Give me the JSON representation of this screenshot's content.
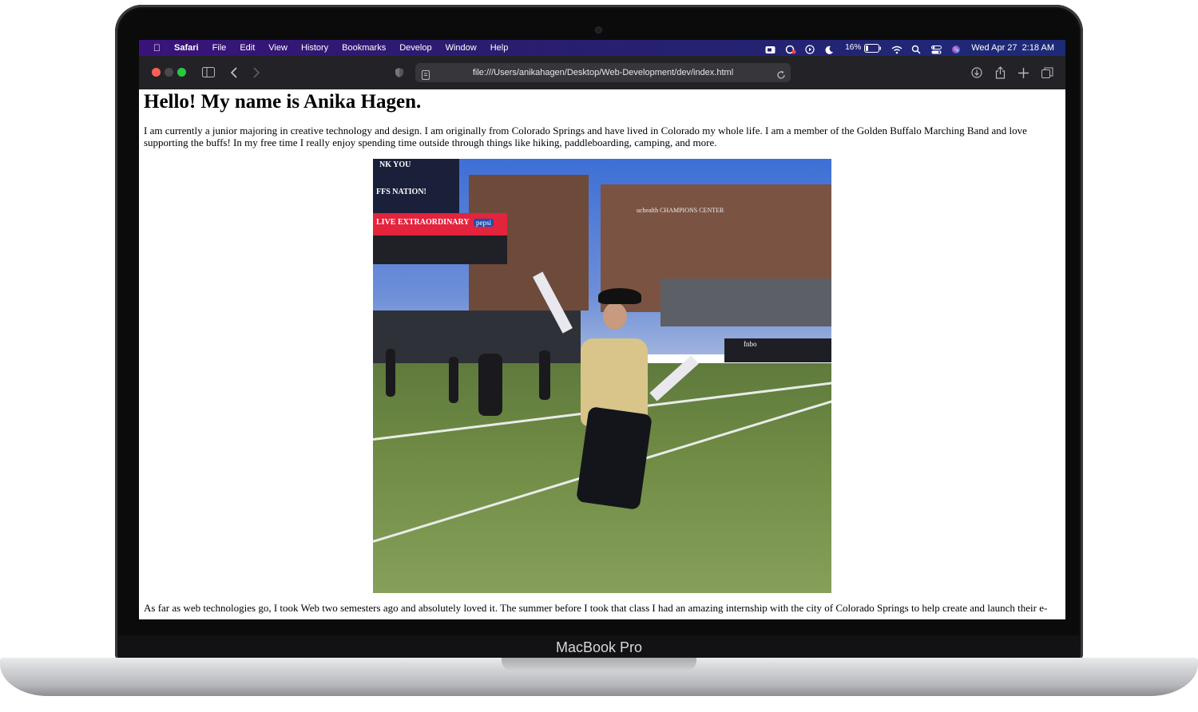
{
  "menubar": {
    "apple_icon": "apple-icon",
    "app_name": "Safari",
    "menus": [
      "File",
      "Edit",
      "View",
      "History",
      "Bookmarks",
      "Develop",
      "Window",
      "Help"
    ],
    "battery_percent": "16%",
    "datetime": "Wed Apr 27  2:18 AM"
  },
  "toolbar": {
    "url": "file:///Users/anikahagen/Desktop/Web-Development/dev/index.html"
  },
  "page": {
    "heading": "Hello! My name is Anika Hagen.",
    "intro": "I am currently a junior majoring in creative technology and design. I am originally from Colorado Springs and have lived in Colorado my whole life. I am a member of the Golden Buffalo Marching Band and love supporting the buffs! In my free time I really enjoy spending time outside through things like hiking, paddleboarding, camping, and more.",
    "second_paragraph": "As far as web technologies go, I took Web two semesters ago and absolutely loved it. The summer before I took that class I had an amazing internship with the city of Colorado Springs to help create and launch their e-",
    "photo": {
      "scoreboard_text": "LIVE EXTRAORDINARY",
      "sponsor": "pepsi",
      "thank_you_text": "NK YOU",
      "nation_text": "FFS NATION!",
      "building_sign": "uchealth CHAMPIONS CENTER",
      "banner_sponsor": "fnbo"
    }
  },
  "device": {
    "brand_label": "MacBook Pro"
  }
}
